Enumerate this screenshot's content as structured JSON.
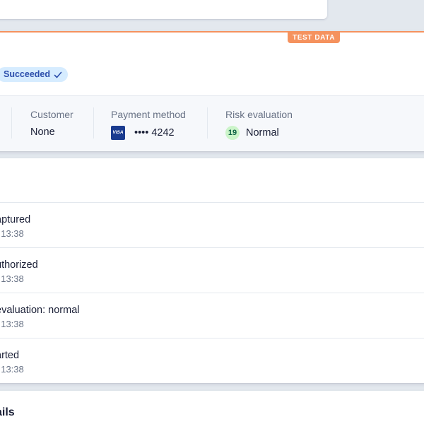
{
  "payment": {
    "test_badge": "TEST DATA",
    "status": "Succeeded",
    "details": {
      "customer": {
        "label": "Customer",
        "value": "None"
      },
      "payment_method": {
        "label": "Payment method",
        "brand": "VISA",
        "value": "•••• 4242"
      },
      "risk": {
        "label": "Risk evaluation",
        "score": "19",
        "value": "Normal"
      }
    }
  },
  "timeline": {
    "events": [
      {
        "title": "aptured",
        "time": ", 13:38"
      },
      {
        "title": "uthorized",
        "time": ", 13:38"
      },
      {
        "title": "evaluation: normal",
        "time": ", 13:38"
      },
      {
        "title": "arted",
        "time": ", 13:38"
      }
    ]
  },
  "bottom": {
    "heading": "ails"
  },
  "colors": {
    "accent_orange": "#f5925e",
    "status_blue": "#2c4eab",
    "risk_green": "#cbf4c9"
  }
}
